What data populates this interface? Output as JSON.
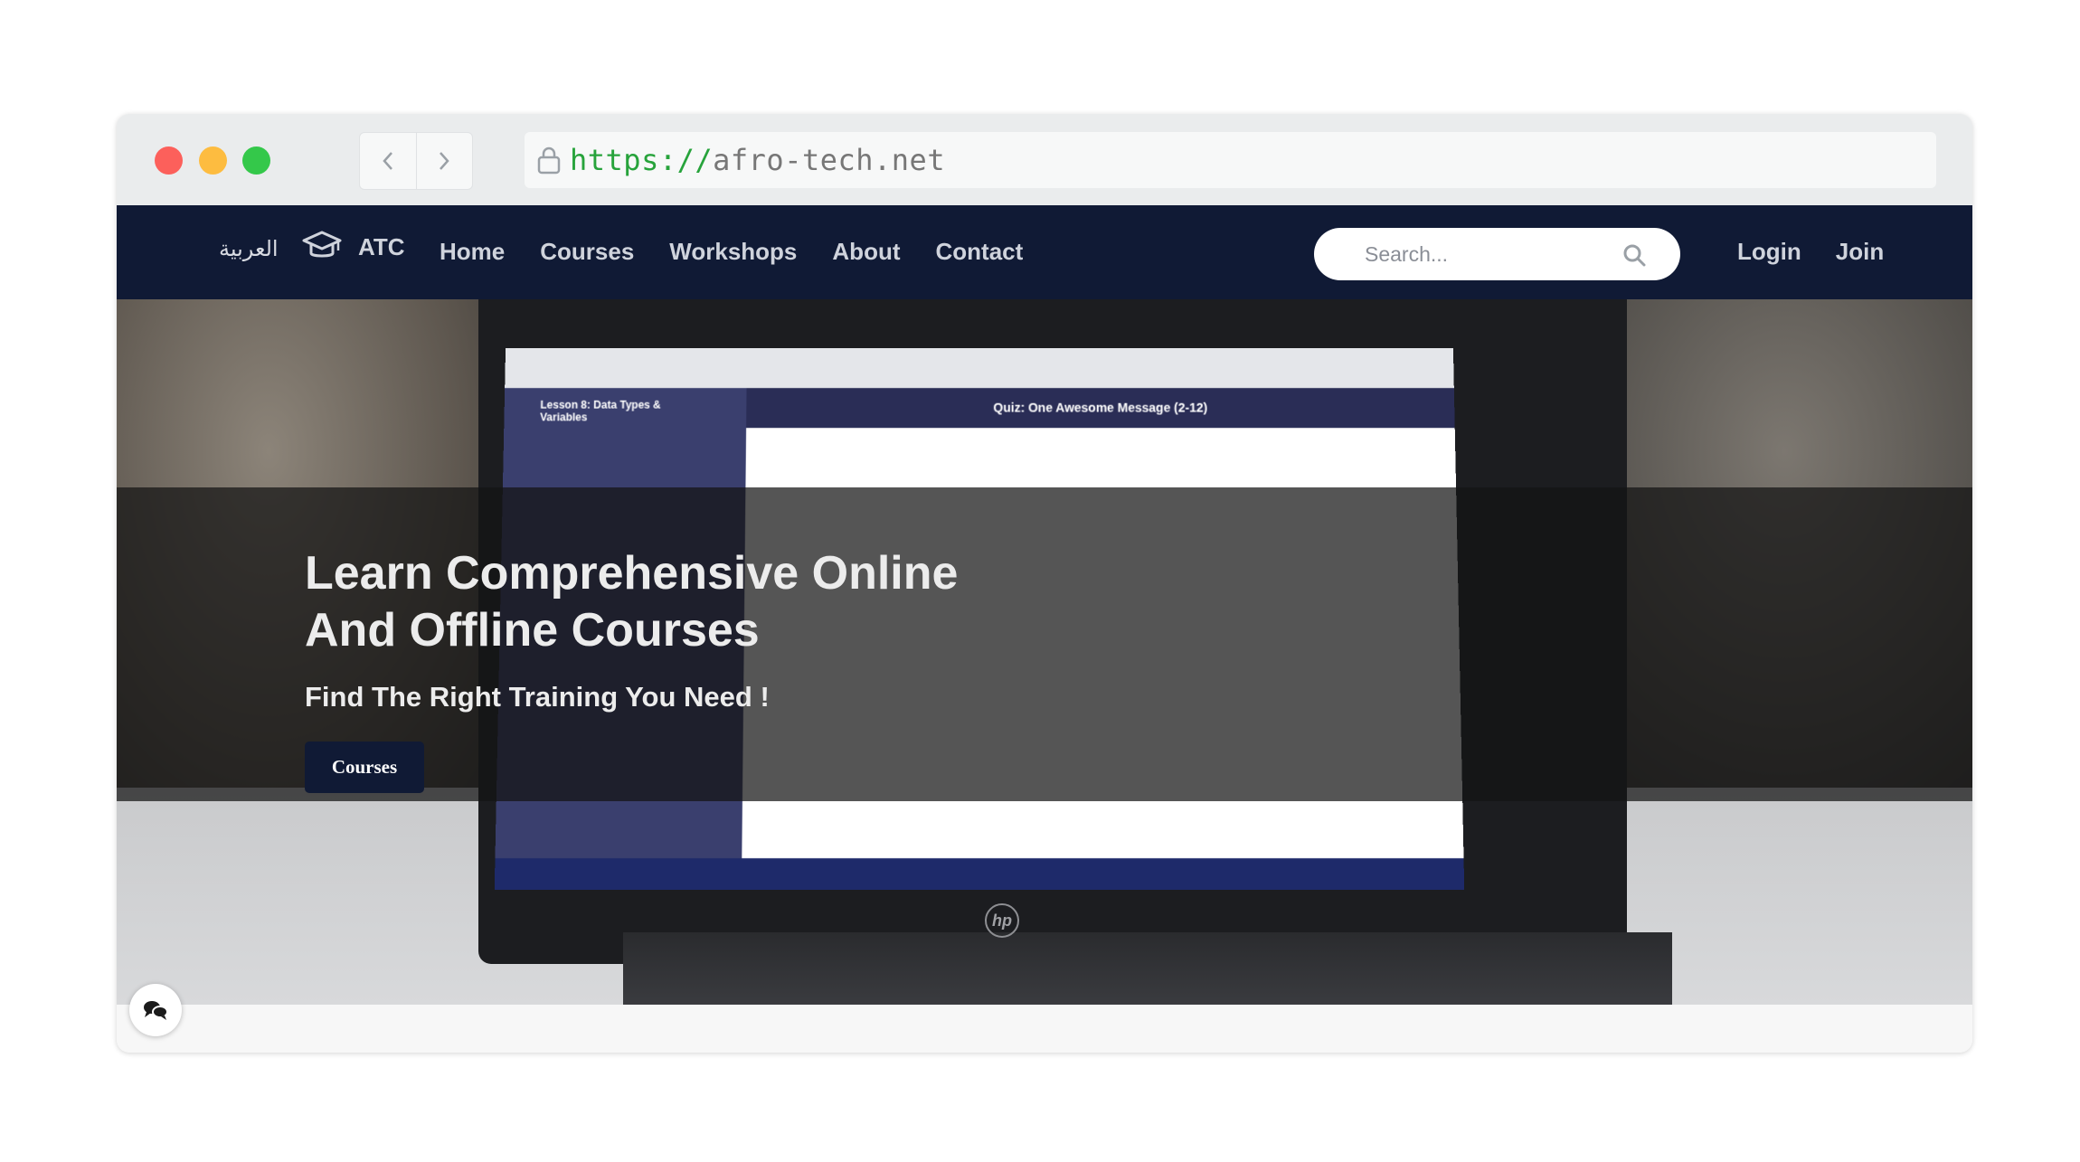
{
  "browser": {
    "url_scheme": "https://",
    "url_host": "afro-tech.net"
  },
  "navbar": {
    "language_link": "العربية",
    "brand_icon": "graduation-cap-icon",
    "brand_label": "ATC",
    "links": [
      "Home",
      "Courses",
      "Workshops",
      "About",
      "Contact"
    ],
    "search_placeholder": "Search...",
    "login_label": "Login",
    "join_label": "Join"
  },
  "hero": {
    "title_line1": "Learn Comprehensive Online",
    "title_line2": "And Offline Courses",
    "subtitle": "Find The Right Training You Need !",
    "button_label": "Courses",
    "laptop_screen_heading": "Quiz: One Awesome Message (2-12)",
    "laptop_screen_lesson": "Lesson 8: Data Types & Variables"
  },
  "colors": {
    "navbar_bg": "#101a35",
    "accent_button": "#101a35",
    "url_scheme": "#27a33b"
  }
}
